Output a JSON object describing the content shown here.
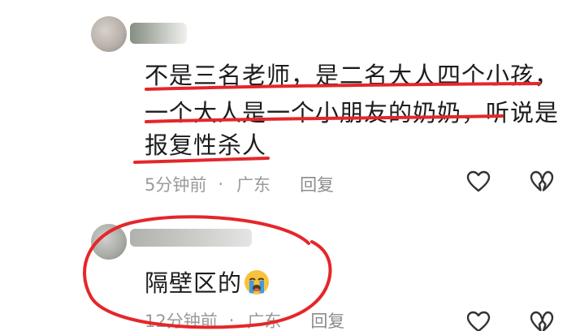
{
  "comments": [
    {
      "lines": [
        "不是三名老师，是二名大人四个小孩，",
        "一个大人是一个小朋友的奶奶，听说是",
        "报复性杀人"
      ],
      "time": "5分钟前",
      "separator": "·",
      "location": "广东",
      "reply_label": "回复",
      "like_icon": "heart-outline-icon",
      "dislike_icon": "broken-heart-icon"
    },
    {
      "text": "隔壁区的",
      "emoji": "loudly-crying-face",
      "time": "12分钟前",
      "separator": "·",
      "location": "广东",
      "reply_label": "回复",
      "like_icon": "heart-outline-icon",
      "dislike_icon": "broken-heart-icon"
    }
  ],
  "colors": {
    "text": "#1c1c1c",
    "meta": "#9a9a9a",
    "annotation_red": "#e5262a",
    "icon": "#333333",
    "emoji_yellow": "#f7c23b",
    "emoji_tear": "#3f9ae6"
  }
}
